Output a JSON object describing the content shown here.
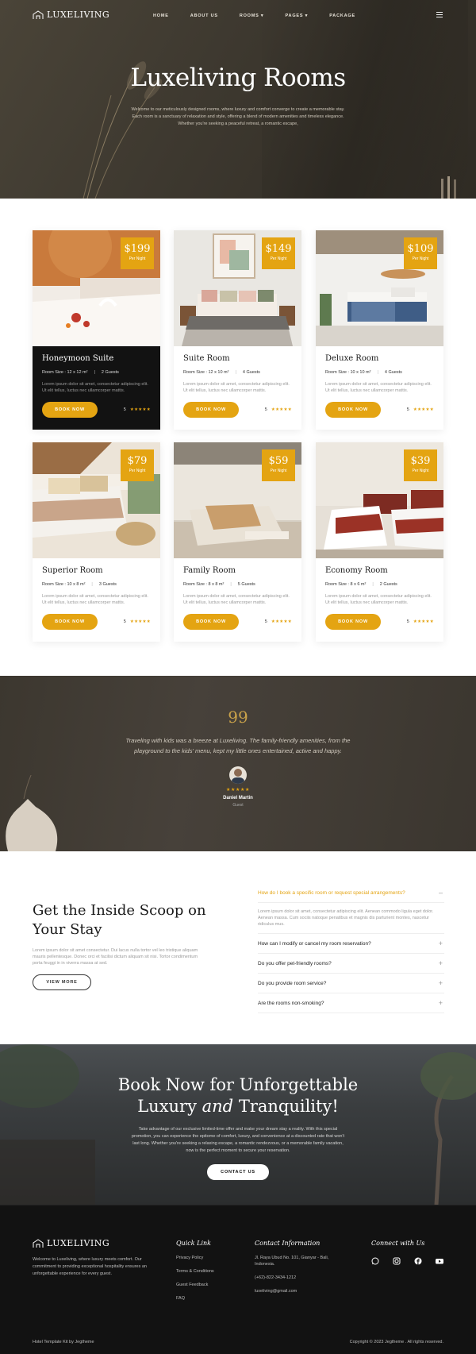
{
  "brand": {
    "name": "LUXELIVING"
  },
  "nav": {
    "items": [
      "HOME",
      "ABOUT US",
      "ROOMS ▾",
      "PAGES ▾",
      "PACKAGE"
    ]
  },
  "hero": {
    "title": "Luxeliving Rooms",
    "subtitle": "Welcome to our meticulously designed rooms, where luxury and comfort converge to create a memorable stay. Each room is a sanctuary of relaxation and style, offering a blend of modern amenities and timeless elegance. Whether you're seeking a peaceful retreat, a romantic escape,"
  },
  "rooms": [
    {
      "name": "Honeymoon Suite",
      "price": "$199",
      "per": "Per Night",
      "size_label": "Room Size : 12 x 12 m²",
      "guests": "2 Guests",
      "desc": "Lorem ipsum dolor sit amet, consectetur adipiscing elit. Ut elit tellus, luctus nec ullamcorper mattis.",
      "book": "BOOK NOW",
      "rating": "5",
      "stars": "★★★★★"
    },
    {
      "name": "Suite Room",
      "price": "$149",
      "per": "Per Night",
      "size_label": "Room Size : 12 x 10 m²",
      "guests": "4 Guests",
      "desc": "Lorem ipsum dolor sit amet, consectetur adipiscing elit. Ut elit tellus, luctus nec ullamcorper mattis.",
      "book": "BOOK NOW",
      "rating": "5",
      "stars": "★★★★★"
    },
    {
      "name": "Deluxe Room",
      "price": "$109",
      "per": "Per Night",
      "size_label": "Room Size : 10 x 10 m²",
      "guests": "4 Guests",
      "desc": "Lorem ipsum dolor sit amet, consectetur adipiscing elit. Ut elit tellus, luctus nec ullamcorper mattis.",
      "book": "BOOK NOW",
      "rating": "5",
      "stars": "★★★★★"
    },
    {
      "name": "Superior Room",
      "price": "$79",
      "per": "Per Night",
      "size_label": "Room Size : 10 x 8 m²",
      "guests": "3 Guests",
      "desc": "Lorem ipsum dolor sit amet, consectetur adipiscing elit. Ut elit tellus, luctus nec ullamcorper mattis.",
      "book": "BOOK NOW",
      "rating": "5",
      "stars": "★★★★★"
    },
    {
      "name": "Family Room",
      "price": "$59",
      "per": "Per Night",
      "size_label": "Room Size : 8 x 8 m²",
      "guests": "5 Guests",
      "desc": "Lorem ipsum dolor sit amet, consectetur adipiscing elit. Ut elit tellus, luctus nec ullamcorper mattis.",
      "book": "BOOK NOW",
      "rating": "5",
      "stars": "★★★★★"
    },
    {
      "name": "Economy Room",
      "price": "$39",
      "per": "Per Night",
      "size_label": "Room Size : 8 x 6 m²",
      "guests": "2 Guests",
      "desc": "Lorem ipsum dolor sit amet, consectetur adipiscing elit. Ut elit tellus, luctus nec ullamcorper mattis.",
      "book": "BOOK NOW",
      "rating": "5",
      "stars": "★★★★★"
    }
  ],
  "testimonial": {
    "quote_mark": "99",
    "text": "Traveling with kids was a breeze at Luxeliving. The family-friendly amenities, from the playground to the kids' menu, kept my little ones entertained, active and happy.",
    "stars": "★★★★★",
    "name": "Daniel Martin",
    "role": "Guest"
  },
  "faq": {
    "title": "Get the Inside Scoop on Your Stay",
    "intro": "Lorem ipsum dolor sit amet consectetur. Dui lacus nulla tortor vel leo tristique aliquam mauris pellentesque. Donec orci et facilisi dictum aliquam sit nisi. Tortor condimentum porta feuggi in in viverra massa at sed.",
    "view_more": "VIEW MORE",
    "open_question": "How do I book a specific room or request special arrangements?",
    "open_answer": "Lorem ipsum dolor sit amet, consectetur adipiscing elit. Aenean commodo ligula eget dolor. Aenean massa. Cum sociis natoque penatibus et magnis dis parturient montes, nascetur ridiculus mus.",
    "questions": [
      "How can I modify or cancel my room reservation?",
      "Do you offer pet-friendly rooms?",
      "Do you provide room service?",
      "Are the rooms non-smoking?"
    ]
  },
  "cta": {
    "title_line1": "Book Now for Unforgettable",
    "title_line2_a": "Luxury ",
    "title_line2_em": "and",
    "title_line2_b": " Tranquility!",
    "text": "Take advantage of our exclusive limited-time offer and make your dream stay a reality. With this special promotion, you can experience the epitome of comfort, luxury, and convenience at a discounted rate that won't last long. Whether you're seeking a relaxing escape, a romantic rendezvous, or a memorable family vacation, now is the perfect moment to secure your reservation.",
    "button": "CONTACT US"
  },
  "footer": {
    "desc": "Welcome to Luxeliving, where luxury meets comfort. Our commitment to providing exceptional hospitality ensures an unforgettable experience for every guest.",
    "quick_title": "Quick Link",
    "quick_links": [
      "Privacy Policy",
      "Terms & Conditions",
      "Guest Feedback",
      "FAQ"
    ],
    "contact_title": "Contact Information",
    "address": "Jl. Raya Ubud No. 101, Gianyar - Bali, Indonesia.",
    "phone": "(+62)-822-3434-1212",
    "email": "luxeliving@gmail.com",
    "social_title": "Connect with Us",
    "credit": "Hotel Template Kit by Jegtheme",
    "copyright": "Copyright © 2023 Jegtheme . All rights reserved."
  },
  "colors": {
    "accent": "#e4a412",
    "dark": "#121212"
  }
}
